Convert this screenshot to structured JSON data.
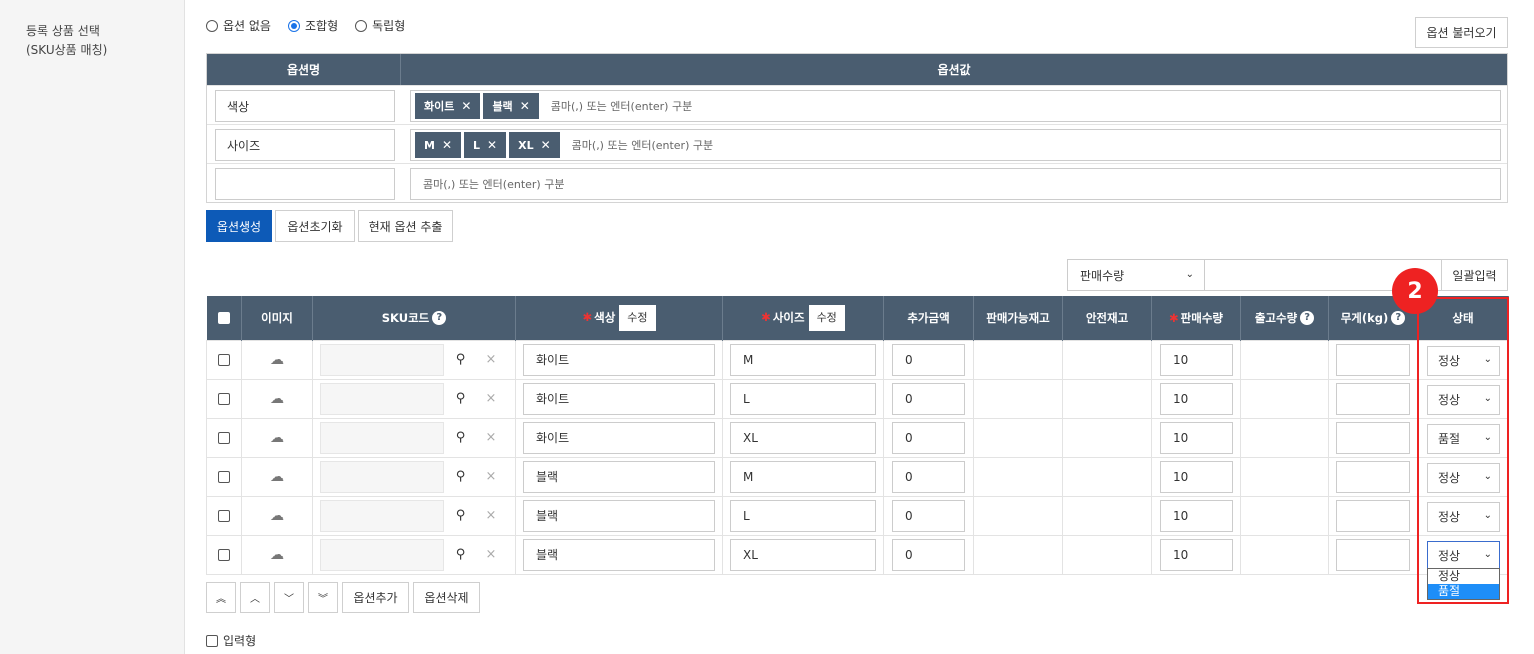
{
  "sidebar": {
    "label_line1": "등록 상품 선택",
    "label_line2": "(SKU상품 매칭)"
  },
  "radio_options": [
    {
      "label": "옵션 없음",
      "selected": false
    },
    {
      "label": "조합형",
      "selected": true
    },
    {
      "label": "독립형",
      "selected": false
    }
  ],
  "load_button": "옵션 불러오기",
  "option_table": {
    "header_name": "옵션명",
    "header_value": "옵션값",
    "placeholder": "콤마(,) 또는 엔터(enter) 구분",
    "rows": [
      {
        "name": "색상",
        "tags": [
          "화이트",
          "블랙"
        ]
      },
      {
        "name": "사이즈",
        "tags": [
          "M",
          "L",
          "XL"
        ]
      },
      {
        "name": "",
        "tags": []
      }
    ]
  },
  "actions": {
    "generate": "옵션생성",
    "reset": "옵션초기화",
    "extract": "현재 옵션 추출"
  },
  "bulk": {
    "select_value": "판매수량",
    "apply": "일괄입력"
  },
  "sku_table": {
    "headers": {
      "image": "이미지",
      "sku": "SKU코드",
      "color": "색상",
      "size": "사이즈",
      "edit": "수정",
      "extra_price": "추가금액",
      "available_stock": "판매가능재고",
      "safety_stock": "안전재고",
      "sale_qty": "판매수량",
      "out_qty": "출고수량",
      "weight": "무게(kg)",
      "status": "상태"
    },
    "rows": [
      {
        "color": "화이트",
        "size": "M",
        "extra": "0",
        "qty": "10",
        "status": "정상"
      },
      {
        "color": "화이트",
        "size": "L",
        "extra": "0",
        "qty": "10",
        "status": "정상"
      },
      {
        "color": "화이트",
        "size": "XL",
        "extra": "0",
        "qty": "10",
        "status": "품절"
      },
      {
        "color": "블랙",
        "size": "M",
        "extra": "0",
        "qty": "10",
        "status": "정상"
      },
      {
        "color": "블랙",
        "size": "L",
        "extra": "0",
        "qty": "10",
        "status": "정상"
      },
      {
        "color": "블랙",
        "size": "XL",
        "extra": "0",
        "qty": "10",
        "status": "정상"
      }
    ]
  },
  "status_dropdown": {
    "options": [
      "정상",
      "품절"
    ],
    "highlighted": "품절"
  },
  "bottom_buttons": {
    "add": "옵션추가",
    "delete": "옵션삭제"
  },
  "input_type_label": "입력형",
  "annotation_badge": "2",
  "icons": {
    "help": "?",
    "search": "⚲",
    "delete": "×",
    "cloud": "☁",
    "chevron": "⌄"
  }
}
